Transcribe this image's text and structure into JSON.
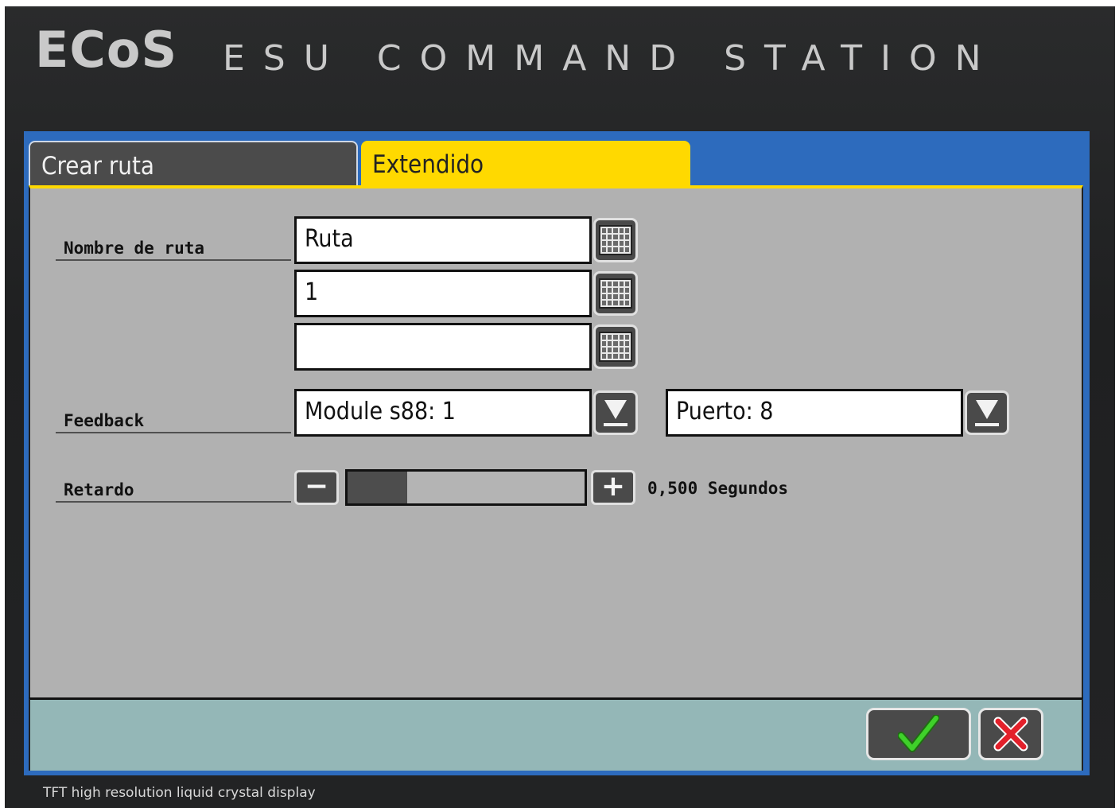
{
  "brand": {
    "logo": "ECoS",
    "subtitle": "ESU COMMAND STATION"
  },
  "tabs": [
    {
      "label": "Crear ruta",
      "active": false
    },
    {
      "label": "Extendido",
      "active": true
    }
  ],
  "form": {
    "nombre_label": "Nombre de ruta",
    "nombre_lines": [
      "Ruta",
      "1",
      ""
    ],
    "feedback_label": "Feedback",
    "feedback_module": "Module s88: 1",
    "feedback_port": "Puerto: 8",
    "retardo_label": "Retardo",
    "retardo_minus": "−",
    "retardo_plus": "+",
    "retardo_fraction": 0.25,
    "retardo_value": "0,500 Segundos"
  },
  "buttons": {
    "confirm_icon": "checkmark-icon",
    "cancel_icon": "x-icon"
  },
  "colors": {
    "active_tab": "#ffd900",
    "panel": "#b1b1b1",
    "footer": "#94b7b7",
    "header_blue": "#2d6bbd",
    "confirm": "#3fd12a",
    "cancel": "#e3202a"
  },
  "caption": "TFT high resolution liquid crystal display"
}
